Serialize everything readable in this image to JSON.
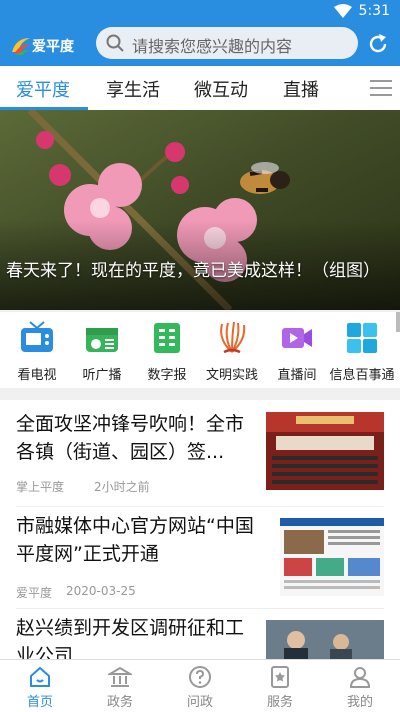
{
  "status": {
    "time": "5:31"
  },
  "header": {
    "logo_text": "爱平度",
    "search_placeholder": "请搜索您感兴趣的内容"
  },
  "tabs": [
    {
      "label": "爱平度",
      "active": true
    },
    {
      "label": "享生活"
    },
    {
      "label": "微互动"
    },
    {
      "label": "直播"
    }
  ],
  "banner": {
    "caption": "春天来了！现在的平度，竟已美成这样！（组图）"
  },
  "quick": [
    {
      "label": "看电视",
      "icon": "tv-icon",
      "color": "#2a8ee0"
    },
    {
      "label": "听广播",
      "icon": "radio-icon",
      "color": "#35b45a"
    },
    {
      "label": "数字报",
      "icon": "newspaper-icon",
      "color": "#34b85c"
    },
    {
      "label": "文明实践",
      "icon": "civilization-logo-icon",
      "color": "#e8692a"
    },
    {
      "label": "直播间",
      "icon": "video-icon",
      "color": "#9b4ddc"
    },
    {
      "label": "信息百事通",
      "icon": "grid-icon",
      "color": "#1fa7e0"
    }
  ],
  "articles": [
    {
      "title": "全面攻坚冲锋号吹响！全市各镇（街道、园区）签...",
      "source": "掌上平度",
      "time": "2小时之前"
    },
    {
      "title": "市融媒体中心官方网站“中国平度网”正式开通",
      "source": "爱平度",
      "time": "2020-03-25"
    },
    {
      "title": "赵兴绩到开发区调研征和工业公司",
      "source": "",
      "time": ""
    }
  ],
  "nav": [
    {
      "label": "首页",
      "icon": "home-icon",
      "active": true
    },
    {
      "label": "政务",
      "icon": "government-icon"
    },
    {
      "label": "问政",
      "icon": "question-icon"
    },
    {
      "label": "服务",
      "icon": "service-icon"
    },
    {
      "label": "我的",
      "icon": "user-icon"
    }
  ],
  "colors": {
    "accent": "#2a8ee0"
  }
}
